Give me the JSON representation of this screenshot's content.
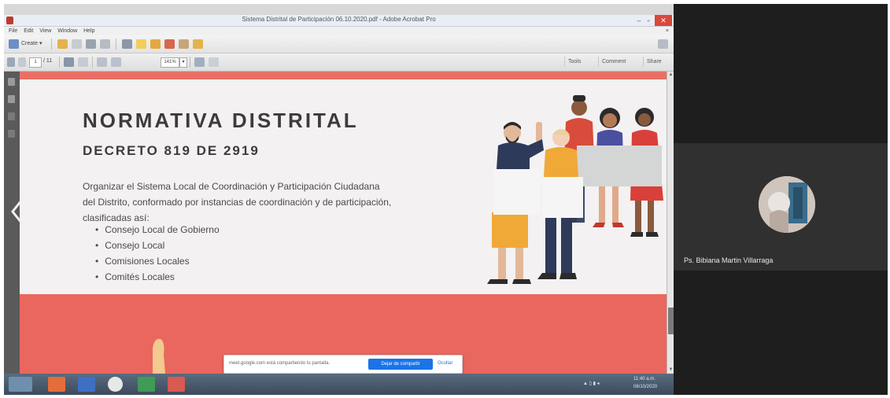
{
  "window": {
    "title": "Sistema Distrital de Participación 06.10.2020.pdf - Adobe Acrobat Pro",
    "min_label": "–",
    "max_label": "▫",
    "close_label": "✕"
  },
  "menu": {
    "items": [
      "File",
      "Edit",
      "View",
      "Window",
      "Help"
    ],
    "close_label": "×"
  },
  "toolbar": {
    "create_label": "Create ▾",
    "page_current": "1",
    "page_total": "/ 11",
    "zoom": "141%",
    "tools_label": "Tools",
    "comment_label": "Comment",
    "share_label": "Share"
  },
  "slide": {
    "heading": "NORMATIVA DISTRITAL",
    "subheading": "DECRETO 819 DE 2919",
    "intro": "Organizar el Sistema Local de Coordinación y Participación Ciudadana del Distrito, conformado por instancias de coordinación y de participación, clasificadas así:",
    "bullets": [
      "Consejo Local de Gobierno",
      "Consejo Local",
      "Comisiones Locales",
      "Comités Locales"
    ]
  },
  "screen_share": {
    "message": "meet.google.com está compartiendo tu pantalla.",
    "stop_label": "Dejar de compartir",
    "hide_label": "Ocultar"
  },
  "taskbar": {
    "time": "11:40 a.m.",
    "date": "06/10/2020"
  },
  "participant": {
    "name": "Ps. Bibiana Martin Villarraga"
  },
  "colors": {
    "slide_coral": "#e9675f",
    "slide_bg": "#f3f1f2",
    "heading_text": "#3f3a3e",
    "meet_blue": "#1a73e8"
  }
}
